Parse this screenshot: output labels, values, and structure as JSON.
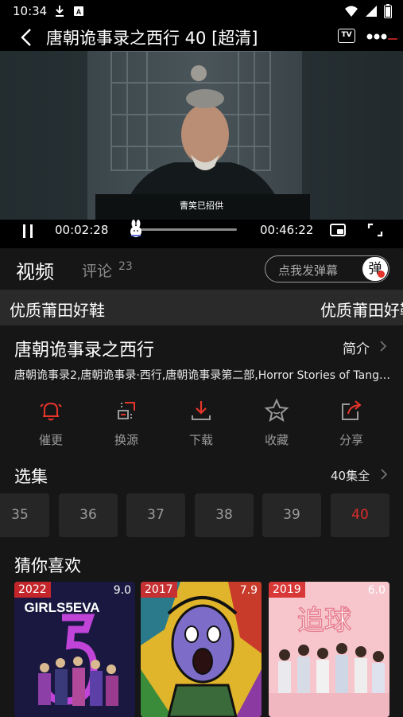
{
  "status_bar": {
    "time": "10:34",
    "left_icons": [
      "download-icon",
      "notification-a-icon"
    ],
    "right_icons": [
      "wifi-icon",
      "signal-icon",
      "battery-icon"
    ]
  },
  "header": {
    "title": "唐朝诡事录之西行 40 [超清]",
    "tv_label": "TV"
  },
  "player": {
    "subtitle": "曹笑已招供",
    "current_time": "00:02:28",
    "total_time": "00:46:22",
    "progress_fraction": 0.053
  },
  "tabs": {
    "video": "视频",
    "comments": "评论",
    "comments_count": "23"
  },
  "danmaku": {
    "placeholder": "点我发弹幕",
    "button": "弹"
  },
  "ad_banner": {
    "text_1": "优质莆田好鞋",
    "text_2": "优质莆田好鞋"
  },
  "show": {
    "title": "唐朝诡事录之西行",
    "intro_link": "简介",
    "alt_names": "唐朝诡事录2,唐朝诡事录·西行,唐朝诡事录第二部,Horror Stories of Tang Dynasty II"
  },
  "actions": [
    {
      "label": "催更",
      "icon": "bell-icon",
      "color": "#e8352c"
    },
    {
      "label": "换源",
      "icon": "switch-source-icon",
      "color": "#9a9a9a"
    },
    {
      "label": "下载",
      "icon": "download-icon",
      "color": "#e8352c"
    },
    {
      "label": "收藏",
      "icon": "star-icon",
      "color": "#9a9a9a"
    },
    {
      "label": "分享",
      "icon": "share-icon",
      "color": "#e8352c"
    }
  ],
  "episodes": {
    "title": "选集",
    "all_label": "40集全",
    "items": [
      "35",
      "36",
      "37",
      "38",
      "39",
      "40"
    ],
    "active": "40"
  },
  "recommendations": {
    "title": "猜你喜欢",
    "items": [
      {
        "year": "2022",
        "score": "9.0",
        "poster_text": "GIRLS5EVA"
      },
      {
        "year": "2017",
        "score": "7.9"
      },
      {
        "year": "2019",
        "score": "6.0",
        "poster_text": "追球"
      }
    ]
  },
  "colors": {
    "accent": "#e02b2b",
    "background": "#161616"
  }
}
